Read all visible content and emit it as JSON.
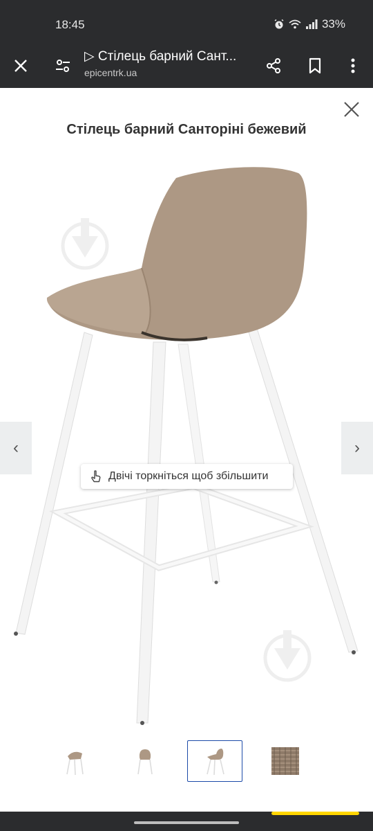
{
  "status": {
    "time": "18:45",
    "battery": "33%"
  },
  "toolbar": {
    "title": "▷ Стілець барний Сант...",
    "url": "epicentrk.ua"
  },
  "viewer": {
    "product_title": "Стілець барний Санторіні бежевий",
    "zoom_hint": "Двічі торкніться щоб збільшити",
    "prev_arrow": "‹",
    "next_arrow": "›"
  },
  "colors": {
    "bar": "#2b2c2e",
    "upholstery": "#ad9884",
    "active_thumb_border": "#1b4aa8",
    "accent": "#ffd600"
  }
}
